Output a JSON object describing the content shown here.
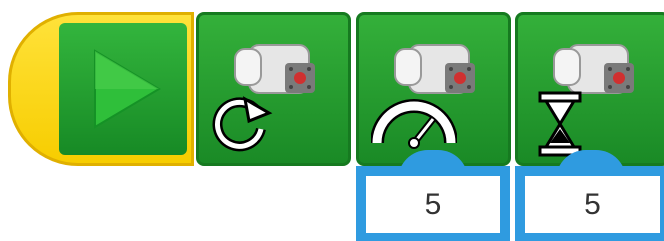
{
  "blocks": [
    {
      "id": "start",
      "icon": "play-icon"
    },
    {
      "id": "motor-on",
      "icon": "rotate-arrow-icon"
    },
    {
      "id": "motor-power",
      "icon": "speedometer-icon"
    },
    {
      "id": "motor-on-for",
      "icon": "hourglass-icon"
    }
  ],
  "params": {
    "power_value": "5",
    "time_value": "5"
  },
  "colors": {
    "start_yellow": "#f7cd00",
    "action_green": "#1a8a26",
    "param_blue": "#2f9be0"
  }
}
